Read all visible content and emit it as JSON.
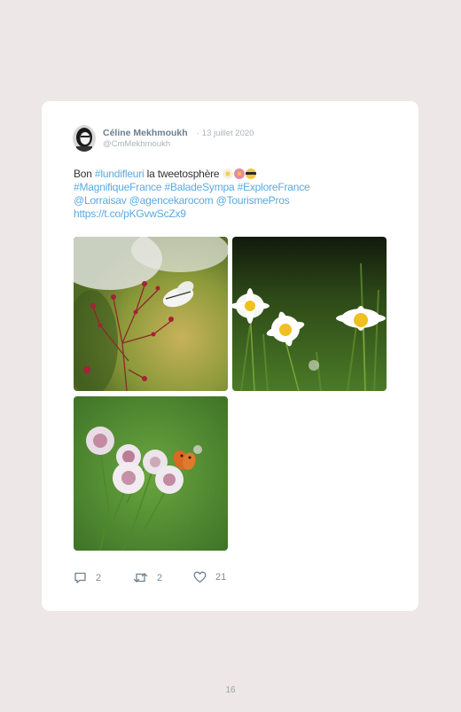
{
  "tweet": {
    "author_name": "Céline Mekhmoukh",
    "date": "· 13 juillet 2020",
    "handle": "@CmMekhmoukh",
    "text": {
      "bon": "Bon ",
      "tag_lundifleuri": "#lundifleuri",
      "tweetosphere": " la tweetosphère ",
      "tag_magnifique": "#MagnifiqueFrance",
      "tag_balade": "#BaladeSympa",
      "tag_explore": "#ExploreFrance",
      "mention_lorraisav": "@Lorraisav",
      "mention_agence": "@agencekarocom",
      "mention_tourisme": "@TourismePros",
      "url": "https://t.co/pKGvwScZx9"
    },
    "emojis": [
      "flower-emoji",
      "hibiscus-emoji",
      "sunglasses-emoji"
    ],
    "images": [
      {
        "name": "photo-butterfly-flowers"
      },
      {
        "name": "photo-daisies"
      },
      {
        "name": "photo-astrantia-butterfly"
      }
    ],
    "stats": {
      "replies": "2",
      "retweets": "2",
      "likes": "21"
    }
  },
  "page_number": "16",
  "colors": {
    "background": "#ede7e7",
    "card": "#ffffff",
    "link": "#5aa9e0",
    "name": "#6a7f8f",
    "muted": "#aab4bc"
  }
}
